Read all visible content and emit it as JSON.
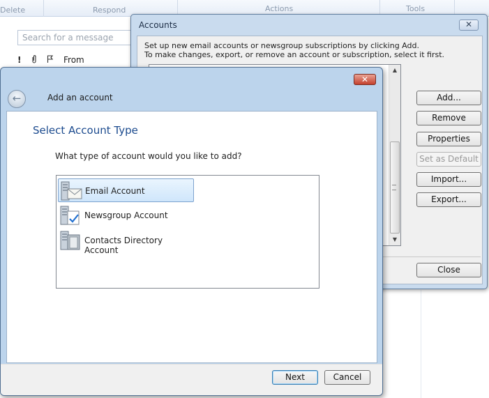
{
  "ribbon": {
    "groups": [
      "Delete",
      "Respond",
      "Actions",
      "Tools"
    ]
  },
  "message_list": {
    "search_placeholder": "Search for a message",
    "columns": {
      "importance": "!",
      "attachment": "attachment-icon",
      "flag": "flag-icon",
      "from": "From"
    }
  },
  "accounts_dialog": {
    "title": "Accounts",
    "close_label": "✕",
    "info_line1": "Set up new email accounts or newsgroup subscriptions by clicking Add.",
    "info_line2": "To make changes, export, or remove an account or subscription, select it first.",
    "buttons": {
      "add": "Add...",
      "remove": "Remove",
      "properties": "Properties",
      "set_default": "Set as Default",
      "import": "Import...",
      "export": "Export...",
      "close": "Close"
    }
  },
  "wizard": {
    "title": "Add an account",
    "heading": "Select Account Type",
    "question": "What type of account would you like to add?",
    "account_types": [
      {
        "label": "Email Account",
        "icon": "email-account-icon",
        "selected": true
      },
      {
        "label": "Newsgroup Account",
        "icon": "newsgroup-account-icon",
        "selected": false
      },
      {
        "label": "Contacts Directory Account",
        "icon": "contacts-directory-icon",
        "selected": false
      }
    ],
    "next_label": "Next",
    "cancel_label": "Cancel",
    "close_label": "✕"
  },
  "colors": {
    "accent_heading": "#1b4a8e",
    "selection_bg": "#cfe6fb",
    "window_frame": "#bcd4ec"
  }
}
